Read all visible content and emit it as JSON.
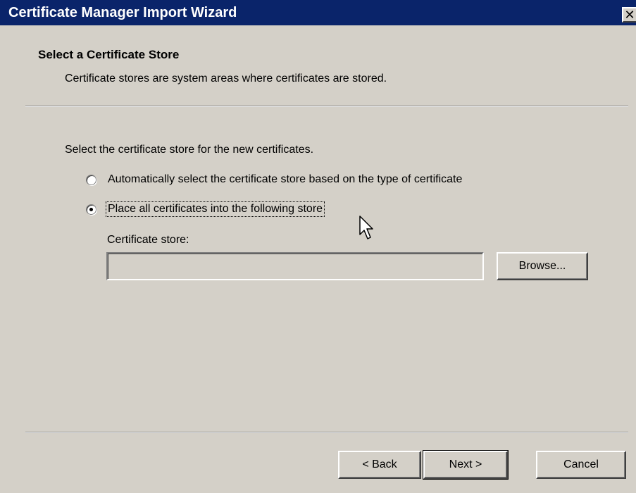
{
  "window": {
    "title": "Certificate Manager Import Wizard",
    "close_glyph": "✕"
  },
  "header": {
    "title": "Select a Certificate Store",
    "description": "Certificate stores are system areas where certificates are stored."
  },
  "body": {
    "prompt": "Select the certificate store for the new certificates.",
    "options": [
      {
        "label": "Automatically select the certificate store based on the type of certificate",
        "checked": false
      },
      {
        "label": "Place all certificates into the following store",
        "checked": true
      }
    ],
    "store_label": "Certificate store:",
    "store_value": ""
  },
  "buttons": {
    "browse": "Browse...",
    "back": "< Back",
    "next": "Next >",
    "cancel": "Cancel"
  }
}
